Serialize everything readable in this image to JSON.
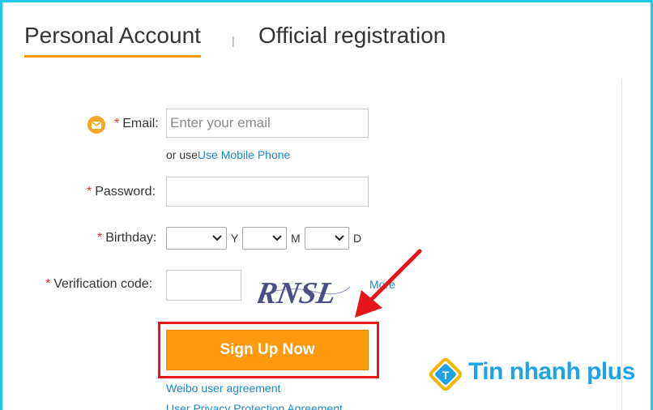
{
  "tabs": {
    "personal": "Personal Account",
    "separator": "|",
    "official": "Official registration"
  },
  "form": {
    "email": {
      "star": "*",
      "label": "Email:",
      "placeholder": "Enter your email",
      "value": ""
    },
    "alt": {
      "prefix": "or use",
      "link": "Use Mobile Phone"
    },
    "password": {
      "star": "*",
      "label": "Password:",
      "value": ""
    },
    "birthday": {
      "star": "*",
      "label": "Birthday:",
      "year_unit": "Y",
      "month_unit": "M",
      "day_unit": "D"
    },
    "verification": {
      "star": "*",
      "label": "Verification code:",
      "value": "",
      "captcha_text": "RNSL",
      "more_link": "More"
    },
    "submit_label": "Sign Up Now",
    "agreements": [
      "Weibo user agreement",
      "User Privacy Protection Agreement"
    ]
  },
  "watermark": {
    "text": "Tin nhanh plus"
  },
  "colors": {
    "frame": "#1ec8e6",
    "accent_tab": "#f39800",
    "required": "#e0302f",
    "link": "#1a8bc9",
    "button": "#ff9a0f",
    "highlight": "#e4161c",
    "watermark": "#1ea2e8"
  },
  "icons": [
    "mail-icon",
    "chevron-down-icon",
    "red-arrow-annotation",
    "tin-nhanh-logo-icon"
  ]
}
